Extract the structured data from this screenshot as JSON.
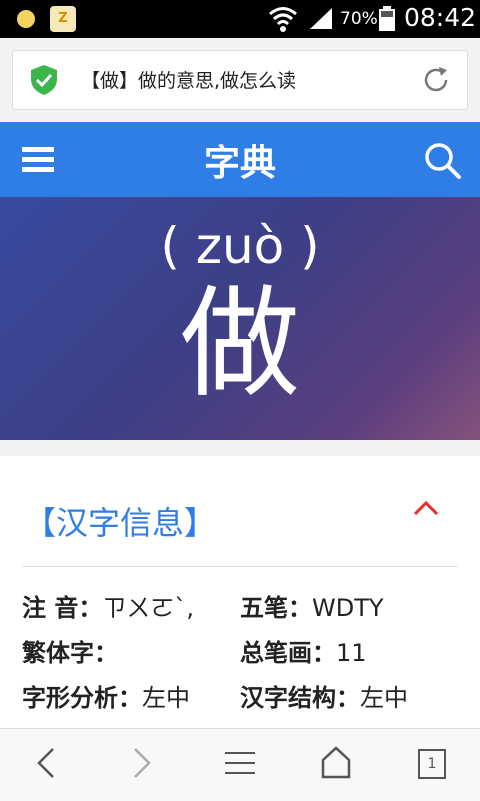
{
  "status_bar": {
    "battery": "70%",
    "time": "08:42",
    "notif_label": "Z"
  },
  "address_bar": {
    "title": "【做】做的意思,做怎么读"
  },
  "header": {
    "title": "字典"
  },
  "hero": {
    "pinyin": "( zuò )",
    "character": "做"
  },
  "info": {
    "section_title": "【汉字信息】",
    "rows": [
      {
        "label": "注 音：",
        "value": "ㄗㄨㄛˋ,"
      },
      {
        "label": "五笔：",
        "value": "WDTY"
      },
      {
        "label": "繁体字：",
        "value": ""
      },
      {
        "label": "总笔画：",
        "value": "11"
      },
      {
        "label": "字形分析：",
        "value": "左中"
      },
      {
        "label": "汉字结构：",
        "value": "左中"
      }
    ]
  },
  "bottom_nav": {
    "tab_count": "1"
  },
  "colors": {
    "accent": "#2f7ee6",
    "hero_start": "#3a4aa0",
    "hero_end": "#86527c",
    "chevron": "#e03030"
  }
}
